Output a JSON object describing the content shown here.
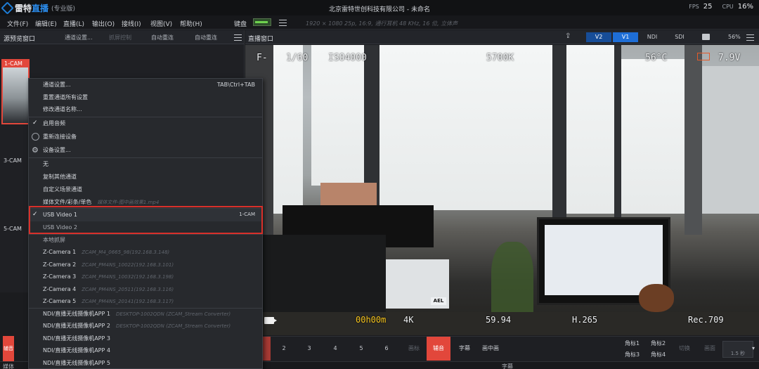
{
  "app": {
    "brand_a": "雷特",
    "brand_b": "直播",
    "edition": "(专业版)",
    "title": "北京雷特世创科技有限公司 - 未命名",
    "fps_label": "FPS",
    "fps_value": "25",
    "cpu_label": "CPU",
    "cpu_value": "16%"
  },
  "menu": [
    "文件(F)",
    "编辑(E)",
    "直播(L)",
    "输出(O)",
    "接线(I)",
    "视图(V)",
    "帮助(H)"
  ],
  "menu_extra": {
    "keyboard": "键盘",
    "format": "1920 × 1080 25p, 16:9, 通行耳机 48 KHz, 16 位, 立体声"
  },
  "preview": {
    "title": "源预览窗口",
    "btn_settings": "通道设置...",
    "btn_crop": "抓屏控制",
    "btn_auto1": "自动重连",
    "btn_auto2": "自动重连",
    "cams": [
      "1-CAM",
      "3-CAM",
      "5-CAM"
    ]
  },
  "context_menu": {
    "items": [
      {
        "label": "通道设置...",
        "shortcut": "TAB\\Ctrl+TAB"
      },
      {
        "label": "重置通道所有设置"
      },
      {
        "label": "修改通道名称..."
      },
      {
        "label": "启用音频"
      },
      {
        "label": "重新连接设备"
      },
      {
        "label": "设备设置..."
      },
      {
        "label": "无"
      },
      {
        "label": "复制其他通道"
      },
      {
        "label": "自定义场景通道"
      },
      {
        "label": "媒体文件/彩条/单色",
        "sub": "媒体文件-图中画效果1.mp4"
      },
      {
        "label": "USB Video 1",
        "shortcut": "1-CAM"
      },
      {
        "label": "USB Video 2"
      },
      {
        "label": "本地抓屏"
      },
      {
        "label": "Z-Camera 1",
        "sub": "ZCAM_M4_0665_98(192.168.3.148)"
      },
      {
        "label": "Z-Camera 2",
        "sub": "ZCAM_PM4NS_10022(192.168.3.101)"
      },
      {
        "label": "Z-Camera 3",
        "sub": "ZCAM_PM4NS_10032(192.168.3.198)"
      },
      {
        "label": "Z-Camera 4",
        "sub": "ZCAM_PM4NS_20511(192.168.3.116)"
      },
      {
        "label": "Z-Camera 5",
        "sub": "ZCAM_PM4NS_20141(192.168.3.117)"
      },
      {
        "label": "NDI/直播无线摄像机APP 1",
        "sub": "DESKTOP-1002QDN (ZCAM_Stream Converter)"
      },
      {
        "label": "NDI/直播无线摄像机APP 2",
        "sub": "DESKTOP-1002QDN (ZCAM_Stream Converter)"
      },
      {
        "label": "NDI/直播无线摄像机APP 3"
      },
      {
        "label": "NDI/直播无线摄像机APP 4"
      },
      {
        "label": "NDI/直播无线摄像机APP 5"
      }
    ]
  },
  "program": {
    "title": "直播窗口",
    "tabs": [
      "V2",
      "V1",
      "NDI",
      "SDI"
    ],
    "zoom": "56%"
  },
  "osd": {
    "iris": "F-",
    "shutter": "1/60",
    "iso": "ISO4000",
    "wb": "5700K",
    "temp": "56°C",
    "voltage": "7.9V",
    "ael": "AEL",
    "timecode": "00h00m",
    "res": "4K",
    "fps": "59.94",
    "codec": "H.265",
    "color": "Rec.709"
  },
  "switcher": {
    "left_label": "辅音",
    "numbers": [
      "2",
      "3",
      "4",
      "5",
      "6"
    ],
    "dim_label": "画标",
    "red_label": "辅音",
    "caption": "字幕",
    "pip": "画中画",
    "corners": [
      "角标1",
      "角标2",
      "角标3",
      "角标4"
    ],
    "switch_btn": "切换",
    "cut_btn": "画面",
    "zoom_value": "1.5 秒"
  },
  "bottom": {
    "media": "媒体",
    "caption": "字幕"
  }
}
